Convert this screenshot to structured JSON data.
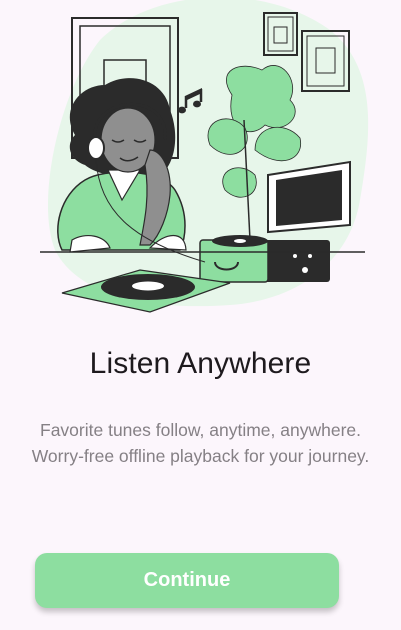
{
  "onboarding": {
    "title": "Listen Anywhere",
    "subtitle_line1": "Favorite tunes follow, anytime, anywhere.",
    "subtitle_line2": "Worry-free offline playback for your journey.",
    "continue_label": "Continue",
    "illustration_icon": "woman-listening-to-record-player-illustration"
  },
  "colors": {
    "background": "#fcf6fc",
    "accent": "#8ddea0",
    "title": "#1e1a1e",
    "subtitle": "#858085"
  }
}
